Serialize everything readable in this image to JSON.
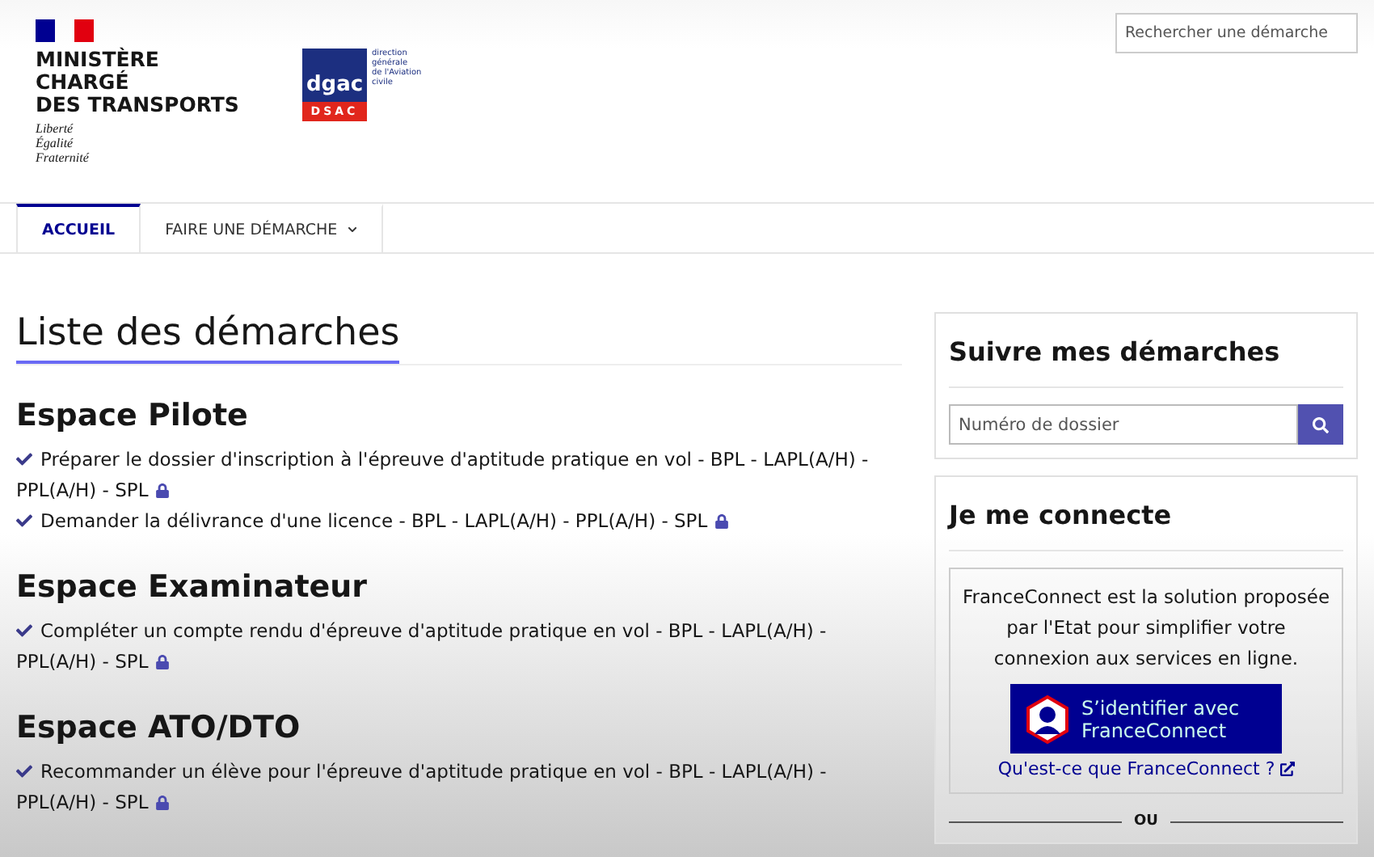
{
  "header": {
    "ministry": {
      "name_lines": [
        "MINISTÈRE",
        "CHARGÉ",
        "DES TRANSPORTS"
      ],
      "motto_lines": [
        "Liberté",
        "Égalité",
        "Fraternité"
      ]
    },
    "agency_logo": {
      "mark": "dgac",
      "caption_lines": [
        "direction",
        "générale",
        "de l'Aviation",
        "civile"
      ],
      "badge": "DSAC"
    },
    "search": {
      "placeholder": "Rechercher une démarche"
    }
  },
  "nav": [
    {
      "label": "ACCUEIL",
      "selected": true,
      "dropdown": false
    },
    {
      "label": "FAIRE UNE DÉMARCHE",
      "selected": false,
      "dropdown": true
    }
  ],
  "main": {
    "title": "Liste des démarches",
    "sections": [
      {
        "title": "Espace Pilote",
        "items": [
          {
            "text": "Préparer le dossier d'inscription à l'épreuve d'aptitude pratique en vol - BPL - LAPL(A/H) - PPL(A/H) - SPL",
            "locked": true
          },
          {
            "text": "Demander la délivrance d'une licence - BPL - LAPL(A/H) - PPL(A/H) - SPL",
            "locked": true
          }
        ]
      },
      {
        "title": "Espace Examinateur",
        "items": [
          {
            "text": "Compléter un compte rendu d'épreuve d'aptitude pratique en vol - BPL - LAPL(A/H) - PPL(A/H) - SPL",
            "locked": true
          }
        ]
      },
      {
        "title": "Espace ATO/DTO",
        "items": [
          {
            "text": "Recommander un élève pour l'épreuve d'aptitude pratique en vol - BPL - LAPL(A/H) - PPL(A/H) - SPL",
            "locked": true
          }
        ]
      }
    ]
  },
  "sidebar": {
    "track": {
      "title": "Suivre mes démarches",
      "placeholder": "Numéro de dossier"
    },
    "login": {
      "title": "Je me connecte",
      "description": "FranceConnect est la solution proposée par l'Etat pour simplifier votre connexion aux services en ligne.",
      "button_lines": [
        "S’identifier avec",
        "FranceConnect"
      ],
      "help_link": "Qu'est-ce que FranceConnect ?",
      "separator": "OU"
    }
  }
}
